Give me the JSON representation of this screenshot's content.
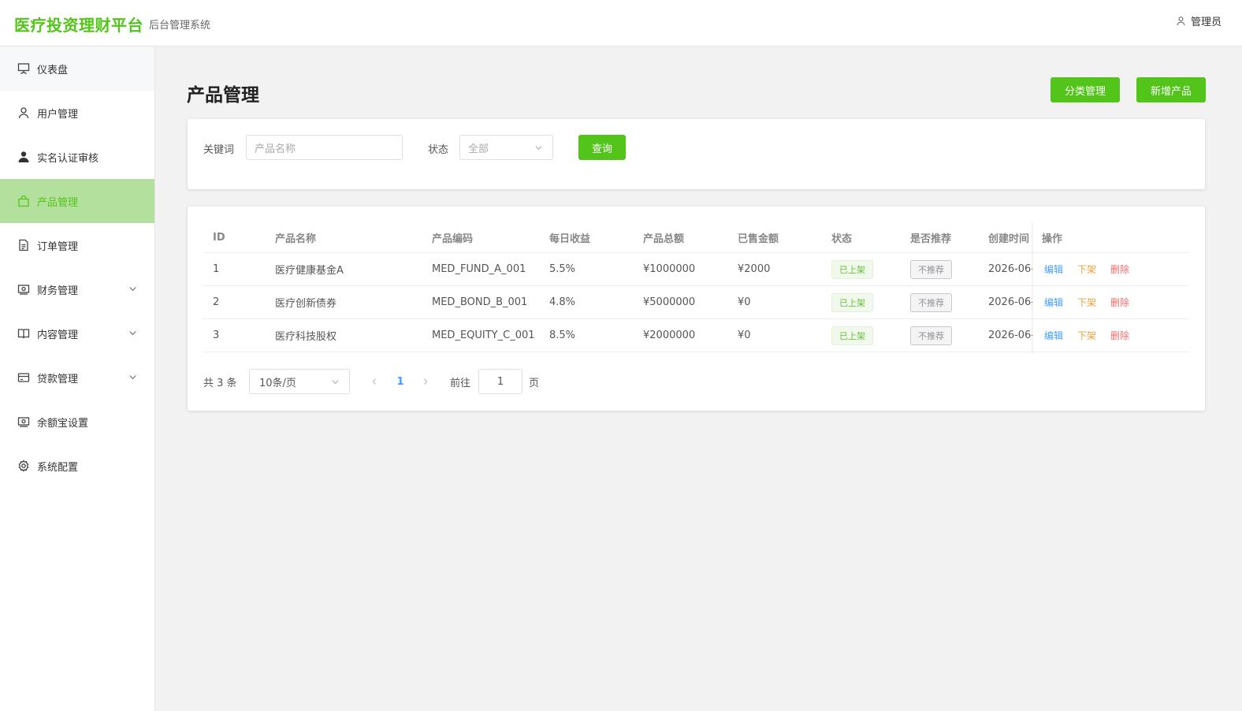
{
  "header": {
    "brand": "医疗投资理财平台",
    "subtitle": "后台管理系统",
    "user": "管理员"
  },
  "sidebar": {
    "items": [
      {
        "label": "仪表盘",
        "icon": "presentation-board-icon"
      },
      {
        "label": "用户管理",
        "icon": "user-icon"
      },
      {
        "label": "实名认证审核",
        "icon": "user-filled-icon"
      },
      {
        "label": "产品管理",
        "icon": "shopping-bag-icon",
        "active": true
      },
      {
        "label": "订单管理",
        "icon": "document-icon"
      },
      {
        "label": "财务管理",
        "icon": "money-icon",
        "expandable": true
      },
      {
        "label": "内容管理",
        "icon": "book-icon",
        "expandable": true
      },
      {
        "label": "贷款管理",
        "icon": "credit-card-icon",
        "expandable": true
      },
      {
        "label": "余额宝设置",
        "icon": "wallet-icon"
      },
      {
        "label": "系统配置",
        "icon": "gear-icon"
      }
    ]
  },
  "page": {
    "title": "产品管理",
    "category_button": "分类管理",
    "add_button": "新增产品"
  },
  "filter": {
    "keyword_label": "关键词",
    "keyword_placeholder": "产品名称",
    "status_label": "状态",
    "status_value": "全部",
    "query_button": "查询"
  },
  "table": {
    "columns": [
      "ID",
      "产品名称",
      "产品编码",
      "每日收益",
      "产品总额",
      "已售金额",
      "状态",
      "是否推荐",
      "创建时间",
      "操作"
    ],
    "rows": [
      {
        "id": "1",
        "name": "医疗健康基金A",
        "code": "MED_FUND_A_001",
        "daily": "5.5%",
        "total": "¥1000000",
        "sold": "¥2000",
        "status": "已上架",
        "recommend": "不推荐",
        "created": "2026-06-"
      },
      {
        "id": "2",
        "name": "医疗创新债券",
        "code": "MED_BOND_B_001",
        "daily": "4.8%",
        "total": "¥5000000",
        "sold": "¥0",
        "status": "已上架",
        "recommend": "不推荐",
        "created": "2026-06-"
      },
      {
        "id": "3",
        "name": "医疗科技股权",
        "code": "MED_EQUITY_C_001",
        "daily": "8.5%",
        "total": "¥2000000",
        "sold": "¥0",
        "status": "已上架",
        "recommend": "不推荐",
        "created": "2026-06-"
      }
    ],
    "actions": {
      "edit": "编辑",
      "offline": "下架",
      "delete": "删除"
    }
  },
  "pagination": {
    "total_text": "共 3 条",
    "page_size": "10条/页",
    "current_page": "1",
    "goto_label": "前往",
    "goto_value": "1",
    "page_suffix": "页"
  },
  "colors": {
    "primary": "#52c41a",
    "active_bg": "#b3e19d",
    "edit": "#409eff",
    "offline": "#e6a23c",
    "delete": "#f56c6c"
  }
}
